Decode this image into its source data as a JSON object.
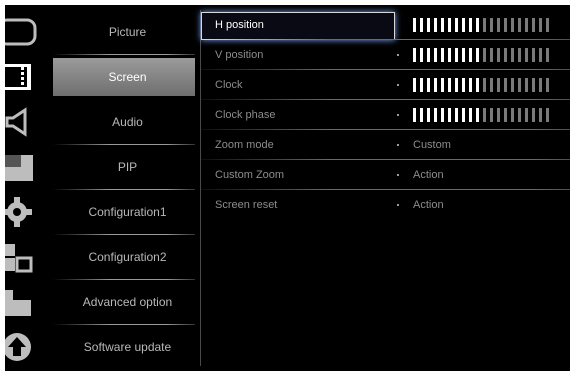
{
  "menu": [
    {
      "label": "Picture",
      "icon": "picture-icon",
      "selected": false
    },
    {
      "label": "Screen",
      "icon": "screen-icon",
      "selected": true
    },
    {
      "label": "Audio",
      "icon": "speaker-icon",
      "selected": false
    },
    {
      "label": "PIP",
      "icon": "pip-icon",
      "selected": false
    },
    {
      "label": "Configuration1",
      "icon": "gear-icon",
      "selected": false
    },
    {
      "label": "Configuration2",
      "icon": "config-icon",
      "selected": false
    },
    {
      "label": "Advanced option",
      "icon": "advanced-icon",
      "selected": false
    },
    {
      "label": "Software update",
      "icon": "upload-icon",
      "selected": false
    }
  ],
  "settings": [
    {
      "name": "H position",
      "type": "slider",
      "level": 0.5,
      "selected": true
    },
    {
      "name": "V position",
      "type": "slider",
      "level": 0.5,
      "selected": false
    },
    {
      "name": "Clock",
      "type": "slider",
      "level": 0.5,
      "selected": false
    },
    {
      "name": "Clock phase",
      "type": "slider",
      "level": 0.5,
      "selected": false
    },
    {
      "name": "Zoom mode",
      "type": "value",
      "value": "Custom",
      "selected": false
    },
    {
      "name": "Custom Zoom",
      "type": "value",
      "value": "Action",
      "selected": false
    },
    {
      "name": "Screen reset",
      "type": "value",
      "value": "Action",
      "selected": false
    }
  ],
  "colors": {
    "highlight_border": "#d8d8d8",
    "glow": "#7aa9ff",
    "bar_active": "#ffffff",
    "bar_inactive": "#7a7a7a"
  }
}
